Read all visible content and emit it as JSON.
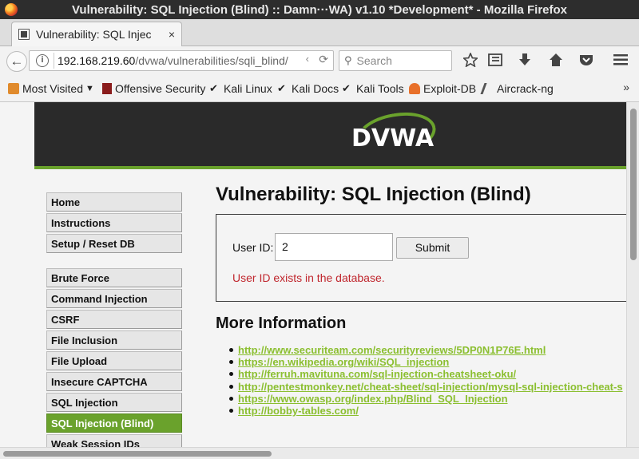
{
  "window": {
    "title": "Vulnerability: SQL Injection (Blind) :: Damn···WA) v1.10 *Development* - Mozilla Firefox"
  },
  "tabs": [
    {
      "label": "Vulnerability: SQL Injec",
      "close": "×"
    }
  ],
  "new_tab": "+",
  "navbar": {
    "url_host": "192.168.219.60",
    "url_path": "/dvwa/vulnerabilities/sqli_blind/",
    "search_placeholder": "Search"
  },
  "bookmarks": [
    {
      "label": "Most Visited",
      "icon": "gear-folder-icon",
      "color": "#e08a2c"
    },
    {
      "label": "Offensive Security",
      "icon": "offsec-icon",
      "color": "#8a1c1c"
    },
    {
      "label": "Kali Linux",
      "icon": "kali-dragon-icon",
      "color": "#222222"
    },
    {
      "label": "Kali Docs",
      "icon": "kali-dragon-icon",
      "color": "#222222"
    },
    {
      "label": "Kali Tools",
      "icon": "kali-dragon-icon",
      "color": "#222222"
    },
    {
      "label": "Exploit-DB",
      "icon": "exploitdb-icon",
      "color": "#e8702a"
    },
    {
      "label": "Aircrack-ng",
      "icon": "aircrack-icon",
      "color": "#555555"
    }
  ],
  "bookmarks_more": "»",
  "dvwa": {
    "logo_text": "DVWA",
    "accent": "#6aa22c",
    "menu": [
      {
        "label": "Home"
      },
      {
        "label": "Instructions"
      },
      {
        "label": "Setup / Reset DB"
      },
      {
        "label": "Brute Force"
      },
      {
        "label": "Command Injection"
      },
      {
        "label": "CSRF"
      },
      {
        "label": "File Inclusion"
      },
      {
        "label": "File Upload"
      },
      {
        "label": "Insecure CAPTCHA"
      },
      {
        "label": "SQL Injection"
      },
      {
        "label": "SQL Injection (Blind)",
        "active": true
      },
      {
        "label": "Weak Session IDs"
      }
    ],
    "page_title": "Vulnerability: SQL Injection (Blind)",
    "form": {
      "label": "User ID:",
      "value": "2",
      "submit": "Submit",
      "result": "User ID exists in the database."
    },
    "more_info_title": "More Information",
    "links": [
      "http://www.securiteam.com/securityreviews/5DP0N1P76E.html",
      "https://en.wikipedia.org/wiki/SQL_injection",
      "http://ferruh.mavituna.com/sql-injection-cheatsheet-oku/",
      "http://pentestmonkey.net/cheat-sheet/sql-injection/mysql-sql-injection-cheat-s",
      "https://www.owasp.org/index.php/Blind_SQL_Injection",
      "http://bobby-tables.com/"
    ]
  }
}
